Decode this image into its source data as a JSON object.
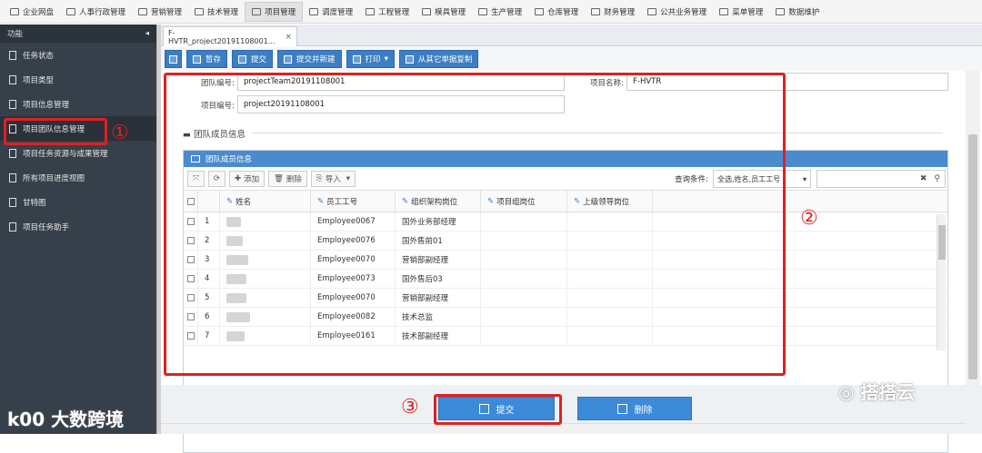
{
  "topnav": {
    "items": [
      "企业网盘",
      "人事行政管理",
      "营销管理",
      "技术管理",
      "项目管理",
      "调度管理",
      "工程管理",
      "模具管理",
      "生产管理",
      "仓库管理",
      "财务管理",
      "公共业务管理",
      "菜单管理",
      "数据维护"
    ],
    "active_index": 4
  },
  "sidebar": {
    "header": "功能",
    "collapse_glyph": "◂",
    "items": [
      "任务状态",
      "项目类型",
      "项目信息管理",
      "项目团队信息管理",
      "项目任务资源与成果管理",
      "所有项目进度视图",
      "甘特图",
      "项目任务助手"
    ],
    "active_index": 3
  },
  "tab": {
    "label": "F-HVTR_project20191108001...",
    "close": "×"
  },
  "toolbar": {
    "save": "暂存",
    "submit": "提交",
    "submit_new": "提交并新建",
    "print": "打印",
    "copy": "从其它单据复制"
  },
  "form": {
    "team_no_label": "团队编号:",
    "team_no_value": "projectTeam20191108001",
    "project_name_label": "项目名称:",
    "project_name_value": "F-HVTR",
    "project_no_label": "项目编号:",
    "project_no_value": "project20191108001"
  },
  "section": {
    "title": "团队成员信息",
    "toggle": "▬"
  },
  "panel": {
    "title": "团队成员信息",
    "tools": {
      "add": "添加",
      "delete": "删除",
      "import": "导入"
    },
    "query_label": "查询条件:",
    "query_value": "全选,姓名,员工工号",
    "clear": "✖",
    "search": "⚲"
  },
  "grid": {
    "columns": [
      "姓名",
      "员工工号",
      "组织架构岗位",
      "项目组岗位",
      "上级领导岗位"
    ],
    "rows": [
      {
        "no": "1",
        "emp": "Employee0067",
        "pos": "国外业务部经理"
      },
      {
        "no": "2",
        "emp": "Employee0076",
        "pos": "国外售前01"
      },
      {
        "no": "3",
        "emp": "Employee0070",
        "pos": "营销部副经理"
      },
      {
        "no": "4",
        "emp": "Employee0073",
        "pos": "国外售后03"
      },
      {
        "no": "5",
        "emp": "Employee0070",
        "pos": "营销部副经理"
      },
      {
        "no": "6",
        "emp": "Employee0082",
        "pos": "技术总监"
      },
      {
        "no": "7",
        "emp": "Employee0161",
        "pos": "技术部副经理"
      }
    ]
  },
  "bottom": {
    "submit": "提交",
    "delete": "删除"
  },
  "annotations": {
    "n1": "①",
    "n2": "②",
    "n3": "③"
  },
  "watermarks": {
    "left_logo": "k00",
    "left_text": "大数跨境",
    "right_text": "搭搭云"
  },
  "colors": {
    "accent": "#3c7ec4",
    "highlight": "#e02020",
    "sidebar": "#36404a"
  }
}
